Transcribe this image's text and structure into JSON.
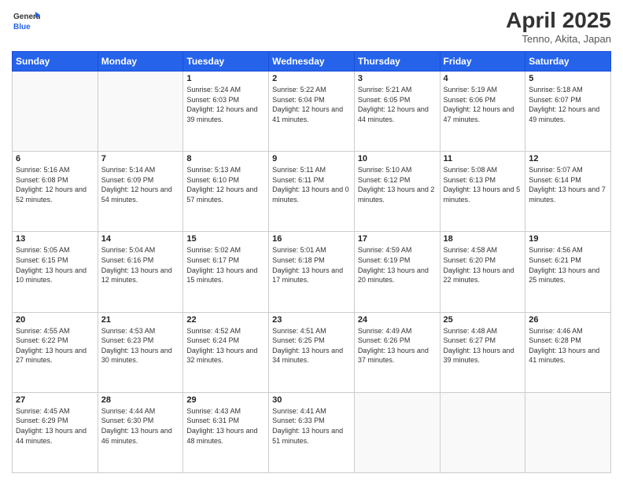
{
  "header": {
    "logo_line1": "General",
    "logo_line2": "Blue",
    "main_title": "April 2025",
    "subtitle": "Tenno, Akita, Japan"
  },
  "days_of_week": [
    "Sunday",
    "Monday",
    "Tuesday",
    "Wednesday",
    "Thursday",
    "Friday",
    "Saturday"
  ],
  "weeks": [
    [
      {
        "day": "",
        "info": ""
      },
      {
        "day": "",
        "info": ""
      },
      {
        "day": "1",
        "info": "Sunrise: 5:24 AM\nSunset: 6:03 PM\nDaylight: 12 hours and 39 minutes."
      },
      {
        "day": "2",
        "info": "Sunrise: 5:22 AM\nSunset: 6:04 PM\nDaylight: 12 hours and 41 minutes."
      },
      {
        "day": "3",
        "info": "Sunrise: 5:21 AM\nSunset: 6:05 PM\nDaylight: 12 hours and 44 minutes."
      },
      {
        "day": "4",
        "info": "Sunrise: 5:19 AM\nSunset: 6:06 PM\nDaylight: 12 hours and 47 minutes."
      },
      {
        "day": "5",
        "info": "Sunrise: 5:18 AM\nSunset: 6:07 PM\nDaylight: 12 hours and 49 minutes."
      }
    ],
    [
      {
        "day": "6",
        "info": "Sunrise: 5:16 AM\nSunset: 6:08 PM\nDaylight: 12 hours and 52 minutes."
      },
      {
        "day": "7",
        "info": "Sunrise: 5:14 AM\nSunset: 6:09 PM\nDaylight: 12 hours and 54 minutes."
      },
      {
        "day": "8",
        "info": "Sunrise: 5:13 AM\nSunset: 6:10 PM\nDaylight: 12 hours and 57 minutes."
      },
      {
        "day": "9",
        "info": "Sunrise: 5:11 AM\nSunset: 6:11 PM\nDaylight: 13 hours and 0 minutes."
      },
      {
        "day": "10",
        "info": "Sunrise: 5:10 AM\nSunset: 6:12 PM\nDaylight: 13 hours and 2 minutes."
      },
      {
        "day": "11",
        "info": "Sunrise: 5:08 AM\nSunset: 6:13 PM\nDaylight: 13 hours and 5 minutes."
      },
      {
        "day": "12",
        "info": "Sunrise: 5:07 AM\nSunset: 6:14 PM\nDaylight: 13 hours and 7 minutes."
      }
    ],
    [
      {
        "day": "13",
        "info": "Sunrise: 5:05 AM\nSunset: 6:15 PM\nDaylight: 13 hours and 10 minutes."
      },
      {
        "day": "14",
        "info": "Sunrise: 5:04 AM\nSunset: 6:16 PM\nDaylight: 13 hours and 12 minutes."
      },
      {
        "day": "15",
        "info": "Sunrise: 5:02 AM\nSunset: 6:17 PM\nDaylight: 13 hours and 15 minutes."
      },
      {
        "day": "16",
        "info": "Sunrise: 5:01 AM\nSunset: 6:18 PM\nDaylight: 13 hours and 17 minutes."
      },
      {
        "day": "17",
        "info": "Sunrise: 4:59 AM\nSunset: 6:19 PM\nDaylight: 13 hours and 20 minutes."
      },
      {
        "day": "18",
        "info": "Sunrise: 4:58 AM\nSunset: 6:20 PM\nDaylight: 13 hours and 22 minutes."
      },
      {
        "day": "19",
        "info": "Sunrise: 4:56 AM\nSunset: 6:21 PM\nDaylight: 13 hours and 25 minutes."
      }
    ],
    [
      {
        "day": "20",
        "info": "Sunrise: 4:55 AM\nSunset: 6:22 PM\nDaylight: 13 hours and 27 minutes."
      },
      {
        "day": "21",
        "info": "Sunrise: 4:53 AM\nSunset: 6:23 PM\nDaylight: 13 hours and 30 minutes."
      },
      {
        "day": "22",
        "info": "Sunrise: 4:52 AM\nSunset: 6:24 PM\nDaylight: 13 hours and 32 minutes."
      },
      {
        "day": "23",
        "info": "Sunrise: 4:51 AM\nSunset: 6:25 PM\nDaylight: 13 hours and 34 minutes."
      },
      {
        "day": "24",
        "info": "Sunrise: 4:49 AM\nSunset: 6:26 PM\nDaylight: 13 hours and 37 minutes."
      },
      {
        "day": "25",
        "info": "Sunrise: 4:48 AM\nSunset: 6:27 PM\nDaylight: 13 hours and 39 minutes."
      },
      {
        "day": "26",
        "info": "Sunrise: 4:46 AM\nSunset: 6:28 PM\nDaylight: 13 hours and 41 minutes."
      }
    ],
    [
      {
        "day": "27",
        "info": "Sunrise: 4:45 AM\nSunset: 6:29 PM\nDaylight: 13 hours and 44 minutes."
      },
      {
        "day": "28",
        "info": "Sunrise: 4:44 AM\nSunset: 6:30 PM\nDaylight: 13 hours and 46 minutes."
      },
      {
        "day": "29",
        "info": "Sunrise: 4:43 AM\nSunset: 6:31 PM\nDaylight: 13 hours and 48 minutes."
      },
      {
        "day": "30",
        "info": "Sunrise: 4:41 AM\nSunset: 6:33 PM\nDaylight: 13 hours and 51 minutes."
      },
      {
        "day": "",
        "info": ""
      },
      {
        "day": "",
        "info": ""
      },
      {
        "day": "",
        "info": ""
      }
    ]
  ]
}
